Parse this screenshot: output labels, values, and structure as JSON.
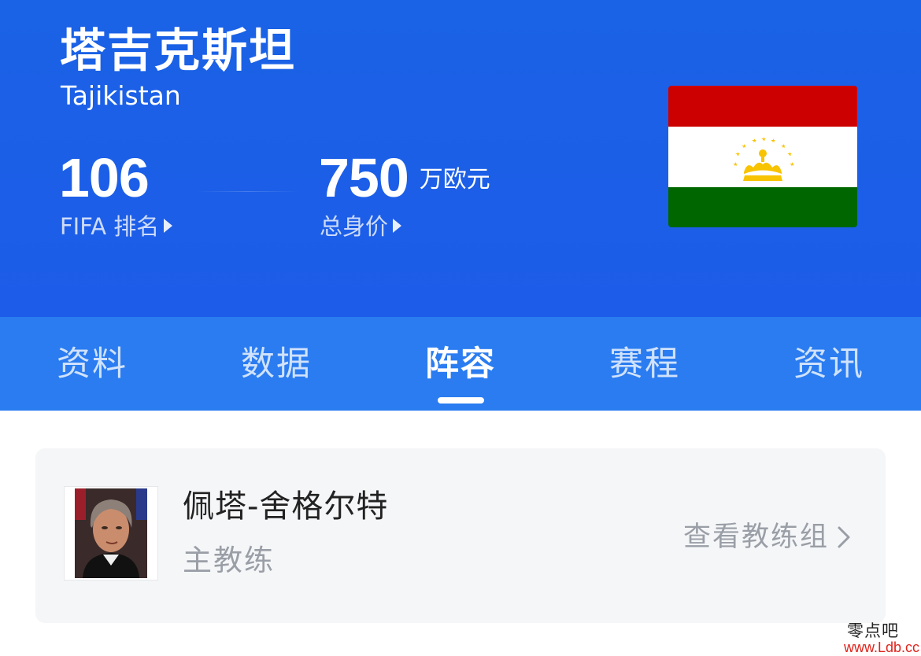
{
  "team": {
    "name_cn": "塔吉克斯坦",
    "name_en": "Tajikistan"
  },
  "stats": {
    "fifa_rank": {
      "value": "106",
      "label": "FIFA 排名"
    },
    "market_value": {
      "value": "750",
      "unit": "万欧元",
      "label": "总身价"
    }
  },
  "flag": {
    "country": "Tajikistan",
    "icon": "tajikistan-flag-icon",
    "colors": {
      "red": "#cc0000",
      "white": "#ffffff",
      "green": "#006600",
      "emblem": "#f8c300"
    }
  },
  "tabs": [
    {
      "label": "资料",
      "active": false
    },
    {
      "label": "数据",
      "active": false
    },
    {
      "label": "阵容",
      "active": true
    },
    {
      "label": "赛程",
      "active": false
    },
    {
      "label": "资讯",
      "active": false
    }
  ],
  "coach": {
    "name": "佩塔-舍格尔特",
    "role": "主教练",
    "link_label": "查看教练组",
    "link_icon": "chevron-right-icon"
  },
  "watermark": {
    "text": "零点吧",
    "url": "www.Ldb.cc"
  },
  "colors": {
    "header_bg": "#1d5ce8",
    "tabs_bg": "#2a7cf0",
    "card_bg": "#f5f6f8",
    "muted_text": "#9a9ea6"
  }
}
